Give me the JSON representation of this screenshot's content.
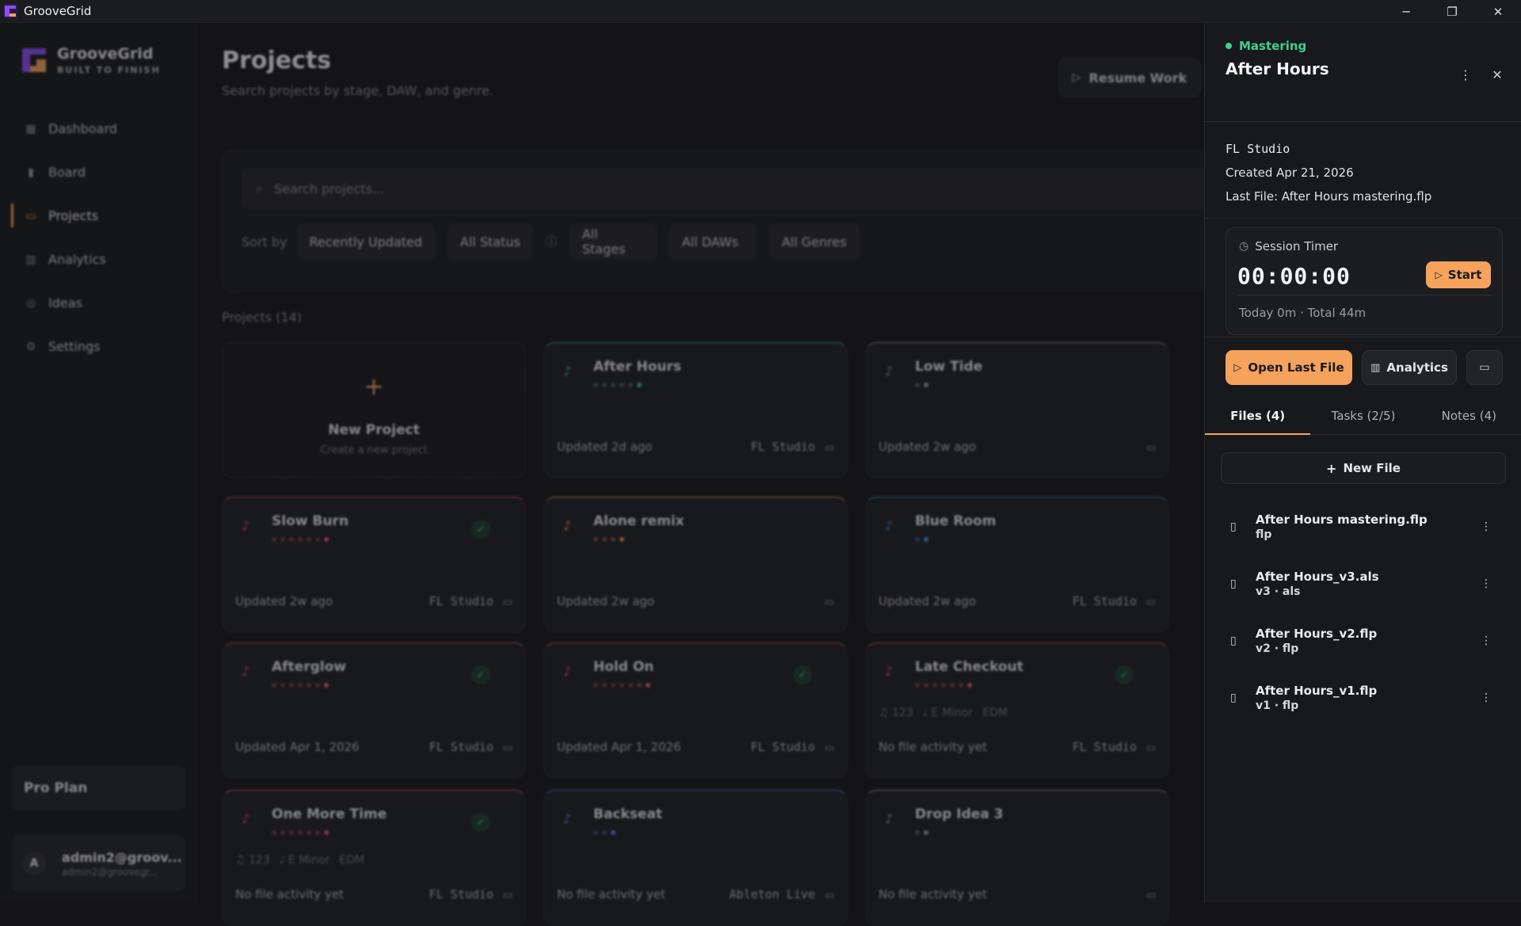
{
  "window": {
    "title": "GrooveGrid",
    "controls": [
      "─",
      "❐",
      "✕"
    ]
  },
  "sidebar": {
    "brand_name": "GrooveGrid",
    "brand_tag": "BUILT TO FINISH",
    "items": [
      {
        "label": "Dashboard",
        "icon": "grid-icon"
      },
      {
        "label": "Board",
        "icon": "board-icon"
      },
      {
        "label": "Projects",
        "icon": "folder-icon"
      },
      {
        "label": "Analytics",
        "icon": "bar-chart-icon"
      },
      {
        "label": "Ideas",
        "icon": "lightbulb-icon"
      },
      {
        "label": "Settings",
        "icon": "gear-icon"
      }
    ],
    "plan": "Pro Plan",
    "user": {
      "initial": "A",
      "name": "admin2@groov...",
      "email": "admin2@groovegr..."
    }
  },
  "main": {
    "title": "Projects",
    "subtitle": "Search projects by stage, DAW, and genre.",
    "resume_label": "Resume Work",
    "search_placeholder": "Search projects...",
    "sort_by": "Sort by",
    "filters": [
      "Recently Updated",
      "All Status",
      "All Stages",
      "All DAWs",
      "All Genres"
    ],
    "count_label": "Projects (14)",
    "new_project": {
      "title": "New Project",
      "subtitle": "Create a new project"
    },
    "cards": [
      {
        "name": "After Hours",
        "updated": "Updated 2d ago",
        "daw": "FL Studio",
        "accent": "#2fbf8a",
        "check": false,
        "meta": []
      },
      {
        "name": "Low Tide",
        "updated": "Updated 2w ago",
        "daw": "",
        "accent": "#9a9aa0",
        "check": false,
        "meta": []
      },
      {
        "name": "Slow Burn",
        "updated": "Updated 2w ago",
        "daw": "FL Studio",
        "accent": "#e0566f",
        "check": true,
        "meta": []
      },
      {
        "name": "Alone remix",
        "updated": "Updated 2w ago",
        "daw": "",
        "accent": "#f08a4b",
        "check": false,
        "meta": []
      },
      {
        "name": "Blue Room",
        "updated": "Updated 2w ago",
        "daw": "FL Studio",
        "accent": "#3a8fd6",
        "check": false,
        "meta": []
      },
      {
        "name": "Afterglow",
        "updated": "Updated Apr 1, 2026",
        "daw": "FL Studio",
        "accent": "#e0566f",
        "check": true,
        "meta": []
      },
      {
        "name": "Hold On",
        "updated": "Updated Apr 1, 2026",
        "daw": "FL Studio",
        "accent": "#e0566f",
        "check": true,
        "meta": []
      },
      {
        "name": "Late Checkout",
        "updated": "No file activity yet",
        "daw": "FL Studio",
        "accent": "#e0566f",
        "check": true,
        "meta": [
          "♫ 123",
          "♩ E Minor",
          "EDM"
        ]
      },
      {
        "name": "One More Time",
        "updated": "No file activity yet",
        "daw": "FL Studio",
        "accent": "#e0566f",
        "check": true,
        "meta": [
          "♫ 123",
          "♩ E Minor",
          "EDM"
        ]
      },
      {
        "name": "Backseat",
        "updated": "No file activity yet",
        "daw": "Ableton Live",
        "accent": "#7a6bf0",
        "check": false,
        "meta": []
      },
      {
        "name": "Drop Idea 3",
        "updated": "No file activity yet",
        "daw": "",
        "accent": "#9a9aa0",
        "check": false,
        "meta": []
      }
    ]
  },
  "panel": {
    "status": "Mastering",
    "status_color": "#3fcf8e",
    "title": "After Hours",
    "daw": "FL Studio",
    "created": "Created Apr 21, 2026",
    "last_file": "Last File: After Hours mastering.flp",
    "timer": {
      "label": "Session Timer",
      "time": "00:00:00",
      "start_label": "Start",
      "footer": "Today 0m · Total 44m"
    },
    "actions": {
      "open_last": "Open Last File",
      "analytics": "Analytics"
    },
    "tabs": [
      "Files (4)",
      "Tasks (2/5)",
      "Notes (4)"
    ],
    "new_file": "New File",
    "files": [
      {
        "name": "After Hours mastering.flp",
        "sub": "flp"
      },
      {
        "name": "After Hours_v3.als",
        "sub": "v3 · als"
      },
      {
        "name": "After Hours_v2.flp",
        "sub": "v2 · flp"
      },
      {
        "name": "After Hours_v1.flp",
        "sub": "v1 · flp"
      }
    ]
  }
}
